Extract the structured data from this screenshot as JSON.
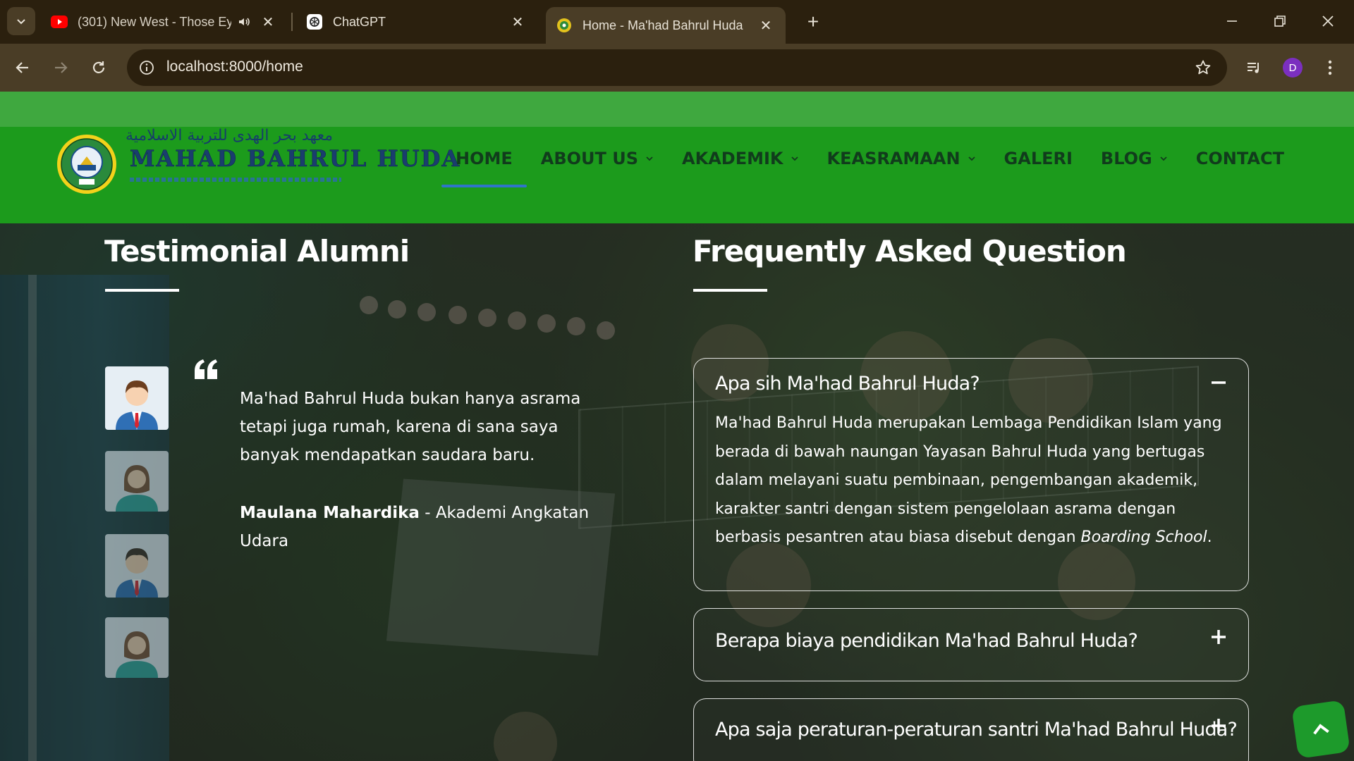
{
  "browser": {
    "tabs": [
      {
        "title": "(301) New West - Those Eyes",
        "icon": "youtube-icon",
        "audio": true
      },
      {
        "title": "ChatGPT",
        "icon": "chatgpt-icon"
      },
      {
        "title": "Home - Ma'had Bahrul Huda",
        "icon": "site-favicon",
        "active": true
      }
    ],
    "url": "localhost:8000/home",
    "profile_initial": "D"
  },
  "site": {
    "logo_arabic": "معهد بحر الهدى للتربية الاسلامية",
    "logo_name": "MAHAD BAHRUL HUDA",
    "brand_green": "#1c9b1c",
    "nav": [
      {
        "label": "HOME",
        "active": true
      },
      {
        "label": "ABOUT US",
        "dropdown": true
      },
      {
        "label": "AKADEMIK",
        "dropdown": true
      },
      {
        "label": "KEASRAMAAN",
        "dropdown": true
      },
      {
        "label": "GALERI"
      },
      {
        "label": "BLOG",
        "dropdown": true
      },
      {
        "label": "CONTACT"
      }
    ]
  },
  "testimonial": {
    "title": "Testimonial Alumni",
    "quote": "Ma'had Bahrul Huda bukan hanya asrama tetapi juga rumah, karena di sana saya banyak mendapatkan saudara baru.",
    "author": "Maulana Mahardika",
    "author_sep": " - ",
    "author_role": "Akademi Angkatan Udara",
    "avatars": [
      "male-student-avatar",
      "female-student-avatar",
      "male-student-avatar",
      "female-student-avatar"
    ]
  },
  "faq": {
    "title": "Frequently Asked Question",
    "items": [
      {
        "question": "Apa sih Ma'had Bahrul Huda?",
        "answer_main": "Ma'had Bahrul Huda merupakan Lembaga Pendidikan Islam yang berada di bawah naungan Yayasan Bahrul Huda yang bertugas dalam melayani suatu pembinaan, pengembangan akademik, karakter santri dengan sistem pengelolaan asrama dengan berbasis pesantren atau biasa disebut dengan ",
        "answer_em": "Boarding School",
        "answer_end": ".",
        "expanded": true
      },
      {
        "question": "Berapa biaya pendidikan Ma'had Bahrul Huda?",
        "expanded": false
      },
      {
        "question": "Apa saja peraturan-peraturan santri Ma'had Bahrul Huda?",
        "expanded": false
      }
    ]
  }
}
